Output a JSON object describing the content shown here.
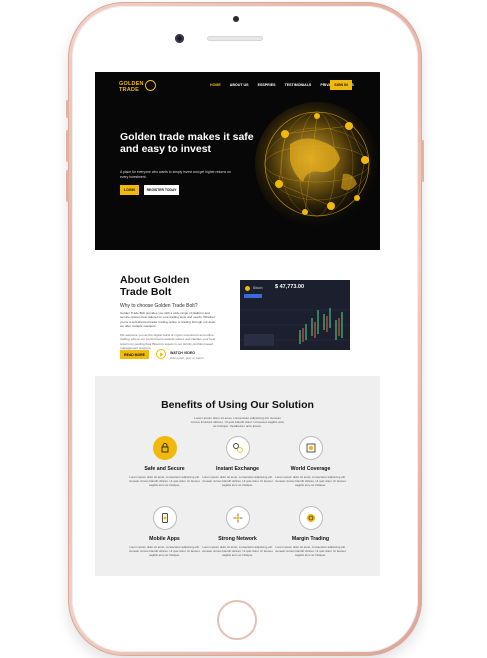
{
  "site": {
    "logo_line1": "GOLDEN",
    "logo_line2": "TRADE",
    "nav": [
      "HOME",
      "ABOUT US",
      "ESSPRIES",
      "TESTIMONIALS",
      "PRIVACY POLICIES"
    ],
    "signin": "SIGN IN",
    "accent": "#f0b90b"
  },
  "hero": {
    "title": "Golden trade makes it safe and easy to invest",
    "subtitle": "A place for everyone who wants to simply invest and get higher returns on every investment.",
    "login": "LOGIN",
    "register": "REGISTER TODAY"
  },
  "about": {
    "title": "About Golden Trade Bolt",
    "subtitle": "Why to choose Golden Trade Bolt?",
    "text": "Golden Trade Bolt provides you with a wide range of platform and service options best tailored to your trading style and needs. Whether you're a self-directed trader trading online or trading through our desk, we offer multiple solutions.",
    "text2": "We welcome you as the digital world of crypto investment and online trading, where our commitment rewards values and clarifies your best returns by pooling their Bitcoin's assets in our strictly portfolio based management program.",
    "read_more": "READ MORE",
    "watch": "WATCH VIDEO",
    "watch_sub": "Video plan, play or watch",
    "dash_label": "Bitcoin",
    "dash_price": "$ 47,773.00"
  },
  "benefits": {
    "title": "Benefits of Using Our Solution",
    "desc": "Lorem ipsum dolor sit amet, consectetur adipiscing elit. Aenean cursus tincidunt ultrices. Ut quis blandit dolor. Ut laoreet sagittis arcu ac tristique. Vestibulum ante ipsum.",
    "items": [
      {
        "title": "Safe and Secure",
        "text": "Lorem ipsum dolor sit amet, consectetur adipiscing elit. Aenean cursus blandit ultrices. Ut quis dolor. Ut laoreet sagittis arcu ac tristique.",
        "icon": "lock-icon"
      },
      {
        "title": "Instant Exchange",
        "text": "Lorem ipsum dolor sit amet, consectetur adipiscing elit. Aenean cursus blandit ultrices. Ut quis dolor. Ut laoreet sagittis arcu ac tristique.",
        "icon": "exchange-icon"
      },
      {
        "title": "World Coverage",
        "text": "Lorem ipsum dolor sit amet, consectetur adipiscing elit. Aenean cursus blandit ultrices. Ut quis dolor. Ut laoreet sagittis arcu ac tristique.",
        "icon": "globe-icon"
      },
      {
        "title": "Mobile Apps",
        "text": "Lorem ipsum dolor sit amet, consectetur adipiscing elit. Aenean cursus blandit ultrices. Ut quis dolor. Ut laoreet sagittis arcu ac tristique.",
        "icon": "phone-icon"
      },
      {
        "title": "Strong Network",
        "text": "Lorem ipsum dolor sit amet, consectetur adipiscing elit. Aenean cursus blandit ultrices. Ut quis dolor. Ut laoreet sagittis arcu ac tristique.",
        "icon": "network-icon"
      },
      {
        "title": "Margin Trading",
        "text": "Lorem ipsum dolor sit amet, consectetur adipiscing elit. Aenean cursus blandit ultrices. Ut quis dolor. Ut laoreet sagittis arcu ac tristique.",
        "icon": "coin-icon"
      }
    ]
  }
}
